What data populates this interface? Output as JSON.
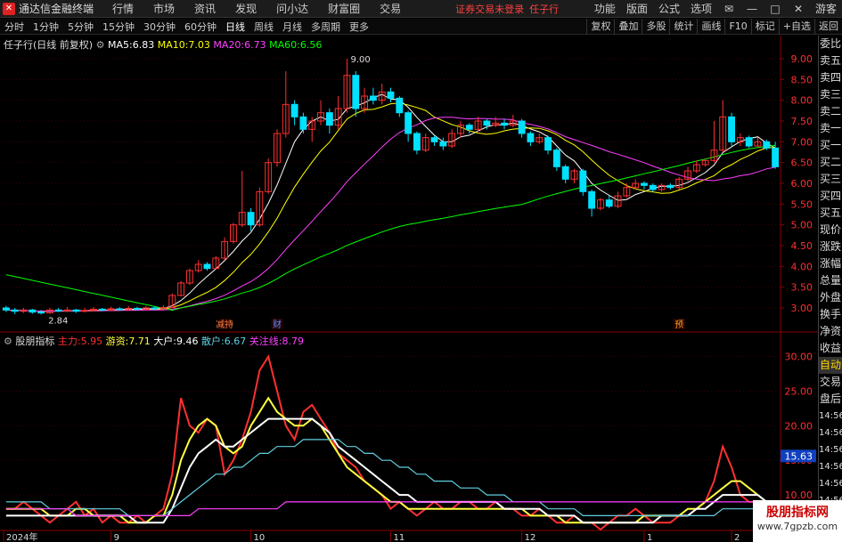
{
  "titlebar": {
    "app_name": "通达信金融终端",
    "menus": [
      "行情",
      "市场",
      "资讯",
      "发现",
      "问小达",
      "财富圈",
      "交易"
    ],
    "warning": "证券交易未登录",
    "stock": "任子行",
    "right_menus": [
      "功能",
      "版面",
      "公式",
      "选项"
    ],
    "user": "游客"
  },
  "toolbar": {
    "periods": [
      "分时",
      "1分钟",
      "5分钟",
      "15分钟",
      "30分钟",
      "60分钟",
      "日线",
      "周线",
      "月线",
      "多周期",
      "更多"
    ],
    "active": "日线",
    "right_buttons": [
      "复权",
      "叠加",
      "多股",
      "统计",
      "画线",
      "F10",
      "标记",
      "+自选",
      "返回"
    ]
  },
  "main_legend": {
    "title": "任子行(日线 前复权)",
    "ma": [
      {
        "label": "MA5:",
        "value": "6.83",
        "color": "#ffffff"
      },
      {
        "label": "MA10:",
        "value": "7.03",
        "color": "#ffff00"
      },
      {
        "label": "MA20:",
        "value": "6.73",
        "color": "#ff40ff"
      },
      {
        "label": "MA60:",
        "value": "6.56",
        "color": "#00ff00"
      }
    ]
  },
  "sub_legend": {
    "title": "股朋指标",
    "items": [
      {
        "label": "主力:",
        "value": "5.95",
        "color": "#ff3030"
      },
      {
        "label": "游资:",
        "value": "7.71",
        "color": "#ffff40"
      },
      {
        "label": "大户:",
        "value": "9.46",
        "color": "#ffffff"
      },
      {
        "label": "散户:",
        "value": "6.67",
        "color": "#60d0e0"
      },
      {
        "label": "关注线:",
        "value": "8.79",
        "color": "#ff40ff"
      }
    ]
  },
  "price_axis": [
    "9.00",
    "8.50",
    "8.00",
    "7.50",
    "7.00",
    "6.50",
    "6.00",
    "5.50",
    "5.00",
    "4.50",
    "4.00",
    "3.50",
    "3.00"
  ],
  "sub_axis": [
    "30.00",
    "25.00",
    "20.00",
    "15.00",
    "10.00"
  ],
  "sub_axis_highlight": "15.63",
  "annotations": {
    "high": "9.00",
    "low": "2.84"
  },
  "event_markers": [
    {
      "text": "减持",
      "color": "#ff8040"
    },
    {
      "text": "财",
      "color": "#6090ff"
    },
    {
      "text": "预",
      "color": "#ffa020"
    }
  ],
  "date_axis": [
    "2024年",
    "9",
    "10",
    "11",
    "12",
    "1",
    "2"
  ],
  "right_panel": [
    "委比",
    "卖五",
    "卖四",
    "卖三",
    "卖二",
    "卖一",
    "买一",
    "买二",
    "买三",
    "买四",
    "买五",
    "现价",
    "涨跌",
    "涨幅",
    "总量",
    "外盘",
    "换手",
    "净资",
    "收益",
    "自动",
    "交易",
    "盘后",
    "14:56",
    "14:56",
    "14:56",
    "14:56",
    "14:56",
    "14:56",
    "14:56"
  ],
  "right_panel_highlight": "自动",
  "watermark": {
    "title": "股朋指标网",
    "url": "www.7gpzb.com"
  },
  "colors": {
    "up": "#ff3030",
    "down": "#00e0ff",
    "background": "#000000",
    "grid": "#400000"
  },
  "chart_data": {
    "type": "candlestick",
    "price_range": [
      2.7,
      9.3
    ],
    "candles": [
      [
        3.0,
        2.95,
        3.05,
        2.9
      ],
      [
        2.95,
        2.92,
        3.0,
        2.85
      ],
      [
        2.92,
        2.95,
        3.0,
        2.88
      ],
      [
        2.95,
        2.9,
        2.98,
        2.86
      ],
      [
        2.9,
        2.88,
        2.95,
        2.84
      ],
      [
        2.88,
        2.95,
        3.0,
        2.86
      ],
      [
        2.95,
        2.93,
        3.0,
        2.9
      ],
      [
        2.93,
        2.95,
        3.02,
        2.9
      ],
      [
        2.95,
        2.92,
        2.98,
        2.88
      ],
      [
        2.92,
        2.94,
        3.0,
        2.89
      ],
      [
        2.94,
        2.97,
        3.02,
        2.92
      ],
      [
        2.97,
        2.95,
        3.0,
        2.92
      ],
      [
        2.95,
        2.98,
        3.03,
        2.93
      ],
      [
        2.98,
        2.96,
        3.02,
        2.93
      ],
      [
        2.96,
        2.99,
        3.05,
        2.94
      ],
      [
        2.99,
        2.97,
        3.03,
        2.94
      ],
      [
        2.97,
        3.0,
        3.05,
        2.95
      ],
      [
        3.0,
        2.98,
        3.04,
        2.95
      ],
      [
        2.98,
        3.01,
        3.06,
        2.96
      ],
      [
        3.01,
        3.3,
        3.35,
        3.0
      ],
      [
        3.3,
        3.6,
        3.65,
        3.28
      ],
      [
        3.6,
        3.9,
        3.95,
        3.55
      ],
      [
        3.9,
        4.05,
        4.15,
        3.85
      ],
      [
        4.05,
        3.95,
        4.1,
        3.9
      ],
      [
        3.95,
        4.2,
        4.25,
        3.92
      ],
      [
        4.2,
        4.6,
        4.7,
        4.15
      ],
      [
        4.6,
        5.0,
        5.05,
        4.55
      ],
      [
        5.0,
        5.3,
        6.3,
        4.95
      ],
      [
        5.3,
        5.0,
        5.4,
        4.85
      ],
      [
        5.0,
        5.8,
        5.9,
        4.95
      ],
      [
        5.8,
        6.5,
        6.6,
        5.75
      ],
      [
        6.5,
        7.2,
        7.3,
        6.4
      ],
      [
        7.2,
        7.9,
        8.7,
        7.1
      ],
      [
        7.9,
        7.6,
        8.0,
        7.4
      ],
      [
        7.6,
        7.3,
        7.7,
        7.2
      ],
      [
        7.3,
        7.5,
        7.6,
        7.0
      ],
      [
        7.5,
        7.7,
        8.0,
        7.4
      ],
      [
        7.7,
        7.4,
        7.8,
        7.2
      ],
      [
        7.4,
        7.8,
        8.1,
        7.3
      ],
      [
        7.8,
        8.6,
        9.0,
        7.7
      ],
      [
        8.6,
        7.8,
        8.7,
        7.6
      ],
      [
        7.8,
        8.1,
        8.3,
        7.7
      ],
      [
        8.1,
        8.0,
        8.3,
        7.9
      ],
      [
        8.0,
        8.2,
        8.4,
        7.9
      ],
      [
        8.2,
        8.05,
        8.3,
        7.95
      ],
      [
        8.05,
        7.7,
        8.1,
        7.6
      ],
      [
        7.7,
        7.2,
        7.75,
        7.0
      ],
      [
        7.2,
        6.8,
        7.25,
        6.7
      ],
      [
        6.8,
        7.1,
        7.2,
        6.75
      ],
      [
        7.1,
        7.0,
        7.15,
        6.9
      ],
      [
        7.0,
        6.9,
        7.1,
        6.8
      ],
      [
        6.9,
        7.2,
        7.3,
        6.85
      ],
      [
        7.2,
        7.4,
        7.5,
        7.1
      ],
      [
        7.4,
        7.3,
        7.45,
        7.2
      ],
      [
        7.3,
        7.5,
        7.6,
        7.25
      ],
      [
        7.5,
        7.4,
        7.55,
        7.3
      ],
      [
        7.4,
        7.45,
        7.6,
        7.35
      ],
      [
        7.45,
        7.4,
        7.55,
        7.3
      ],
      [
        7.4,
        7.5,
        7.65,
        7.35
      ],
      [
        7.5,
        7.2,
        7.55,
        7.1
      ],
      [
        7.2,
        7.0,
        7.25,
        6.9
      ],
      [
        7.0,
        7.1,
        7.2,
        6.95
      ],
      [
        7.1,
        6.8,
        7.15,
        6.7
      ],
      [
        6.8,
        6.4,
        6.85,
        6.3
      ],
      [
        6.4,
        6.1,
        6.45,
        6.0
      ],
      [
        6.1,
        6.3,
        6.35,
        6.0
      ],
      [
        6.3,
        5.8,
        6.35,
        5.7
      ],
      [
        5.8,
        5.4,
        5.85,
        5.2
      ],
      [
        5.4,
        5.6,
        5.65,
        5.35
      ],
      [
        5.6,
        5.45,
        5.7,
        5.4
      ],
      [
        5.45,
        5.7,
        5.8,
        5.4
      ],
      [
        5.7,
        5.9,
        6.0,
        5.65
      ],
      [
        5.9,
        6.0,
        6.1,
        5.85
      ],
      [
        6.0,
        5.95,
        6.05,
        5.85
      ],
      [
        5.95,
        5.85,
        6.0,
        5.8
      ],
      [
        5.85,
        5.95,
        6.0,
        5.8
      ],
      [
        5.95,
        5.9,
        6.0,
        5.85
      ],
      [
        5.9,
        6.1,
        6.15,
        5.85
      ],
      [
        6.1,
        6.3,
        6.4,
        6.05
      ],
      [
        6.3,
        6.45,
        6.55,
        6.25
      ],
      [
        6.45,
        6.55,
        6.6,
        6.4
      ],
      [
        6.55,
        6.8,
        7.5,
        6.5
      ],
      [
        6.8,
        7.6,
        8.0,
        6.75
      ],
      [
        7.6,
        7.0,
        7.7,
        6.9
      ],
      [
        7.0,
        7.1,
        7.2,
        6.9
      ],
      [
        7.1,
        6.9,
        7.15,
        6.85
      ],
      [
        6.9,
        7.0,
        7.1,
        6.85
      ],
      [
        7.0,
        6.85,
        7.05,
        6.8
      ],
      [
        6.85,
        6.4,
        7.0,
        6.35
      ]
    ]
  },
  "indicator_data": {
    "type": "line",
    "range": [
      5,
      32
    ],
    "series": [
      {
        "name": "主力",
        "color": "#ff3030",
        "values": [
          8,
          8,
          9,
          8,
          7,
          6,
          7,
          8,
          9,
          7,
          8,
          6,
          7,
          6,
          6,
          7,
          6,
          7,
          8,
          13,
          24,
          20,
          19,
          21,
          20,
          13,
          15,
          18,
          22,
          28,
          30,
          25,
          20,
          18,
          22,
          23,
          21,
          19,
          16,
          15,
          14,
          12,
          11,
          10,
          8,
          9,
          8,
          7,
          8,
          9,
          8,
          8,
          9,
          9,
          8,
          8,
          9,
          8,
          8,
          7,
          7,
          8,
          7,
          6,
          6,
          7,
          6,
          6,
          5,
          6,
          7,
          7,
          8,
          7,
          6,
          6,
          6,
          7,
          7,
          8,
          9,
          12,
          17,
          14,
          10,
          9,
          9,
          8,
          6
        ]
      },
      {
        "name": "游资",
        "color": "#ffff40",
        "values": [
          8,
          8,
          8,
          8,
          8,
          7,
          7,
          7,
          8,
          8,
          7,
          7,
          7,
          7,
          6,
          6,
          6,
          7,
          7,
          10,
          15,
          18,
          20,
          21,
          20,
          17,
          16,
          17,
          20,
          22,
          24,
          22,
          21,
          20,
          20,
          21,
          20,
          18,
          16,
          14,
          13,
          12,
          11,
          10,
          9,
          9,
          8,
          8,
          8,
          8,
          8,
          8,
          8,
          8,
          8,
          8,
          8,
          8,
          8,
          8,
          7,
          7,
          7,
          7,
          6,
          6,
          6,
          6,
          6,
          6,
          6,
          6,
          6,
          7,
          7,
          7,
          7,
          7,
          8,
          8,
          9,
          10,
          11,
          12,
          12,
          11,
          10,
          9,
          8
        ]
      },
      {
        "name": "大户",
        "color": "#ffffff",
        "values": [
          7,
          7,
          7,
          7,
          7,
          7,
          7,
          7,
          7,
          7,
          7,
          7,
          7,
          7,
          7,
          6,
          6,
          6,
          6,
          8,
          11,
          14,
          16,
          17,
          18,
          17,
          17,
          18,
          19,
          20,
          21,
          21,
          21,
          21,
          21,
          21,
          20,
          19,
          17,
          16,
          15,
          14,
          13,
          12,
          11,
          10,
          10,
          9,
          9,
          9,
          9,
          9,
          9,
          9,
          9,
          9,
          9,
          8,
          8,
          8,
          8,
          8,
          7,
          7,
          7,
          7,
          6,
          6,
          6,
          6,
          6,
          6,
          6,
          6,
          6,
          7,
          7,
          7,
          7,
          8,
          8,
          9,
          10,
          10,
          10,
          10,
          10,
          9,
          9
        ]
      },
      {
        "name": "散户",
        "color": "#60d0e0",
        "values": [
          9,
          9,
          9,
          9,
          9,
          8,
          8,
          8,
          8,
          8,
          8,
          8,
          8,
          8,
          7,
          7,
          7,
          7,
          7,
          8,
          9,
          10,
          11,
          12,
          13,
          13,
          14,
          14,
          15,
          16,
          16,
          17,
          17,
          17,
          18,
          18,
          18,
          18,
          18,
          17,
          17,
          16,
          16,
          15,
          15,
          14,
          14,
          13,
          13,
          12,
          12,
          12,
          11,
          11,
          11,
          10,
          10,
          10,
          9,
          9,
          9,
          9,
          8,
          8,
          8,
          8,
          7,
          7,
          7,
          7,
          7,
          7,
          7,
          7,
          7,
          7,
          7,
          7,
          7,
          7,
          7,
          7,
          8,
          8,
          8,
          8,
          8,
          8,
          9
        ]
      },
      {
        "name": "关注线",
        "color": "#ff40ff",
        "values": [
          8,
          8,
          8,
          8,
          8,
          8,
          8,
          8,
          7,
          7,
          7,
          7,
          7,
          7,
          7,
          7,
          7,
          7,
          7,
          7,
          7,
          7,
          8,
          8,
          8,
          8,
          8,
          8,
          8,
          8,
          8,
          8,
          9,
          9,
          9,
          9,
          9,
          9,
          9,
          9,
          9,
          9,
          9,
          9,
          9,
          9,
          9,
          9,
          9,
          9,
          9,
          9,
          9,
          9,
          9,
          9,
          9,
          9,
          9,
          9,
          9,
          9,
          9,
          9,
          9,
          9,
          9,
          9,
          9,
          9,
          9,
          9,
          9,
          9,
          9,
          9,
          9,
          9,
          9,
          9,
          9,
          9,
          9,
          9,
          9,
          9,
          9,
          9,
          9
        ]
      }
    ]
  }
}
